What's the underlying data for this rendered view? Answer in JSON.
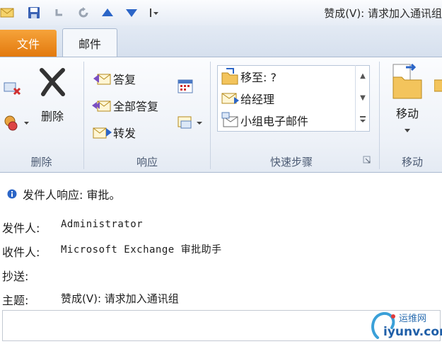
{
  "window": {
    "title": "赞成(V): 请求加入通讯组"
  },
  "tabs": {
    "file": "文件",
    "mail": "邮件"
  },
  "ribbon": {
    "delete_group": {
      "label": "删除",
      "delete_button": "删除"
    },
    "respond_group": {
      "label": "响应",
      "reply": "答复",
      "reply_all": "全部答复",
      "forward": "转发"
    },
    "quicksteps_group": {
      "label": "快速步骤",
      "items": [
        "移至: ?",
        "给经理",
        "小组电子邮件"
      ]
    },
    "move_group": {
      "label": "移动",
      "move_button": "移动"
    }
  },
  "info_bar": {
    "text": "发件人响应: 审批。"
  },
  "header": {
    "from_label": "发件人:",
    "from_value": "Administrator",
    "to_label": "收件人:",
    "to_value": "Microsoft Exchange 审批助手",
    "cc_label": "抄送:",
    "cc_value": "",
    "subject_label": "主题:",
    "subject_value": "赞成(V): 请求加入通讯组"
  },
  "watermark": {
    "text1": "运维网",
    "text2": "iyunv.com"
  },
  "colors": {
    "file_tab": "#e8831a",
    "ribbon_bg": "#eef2f8",
    "accent_blue": "#2b65c7"
  }
}
